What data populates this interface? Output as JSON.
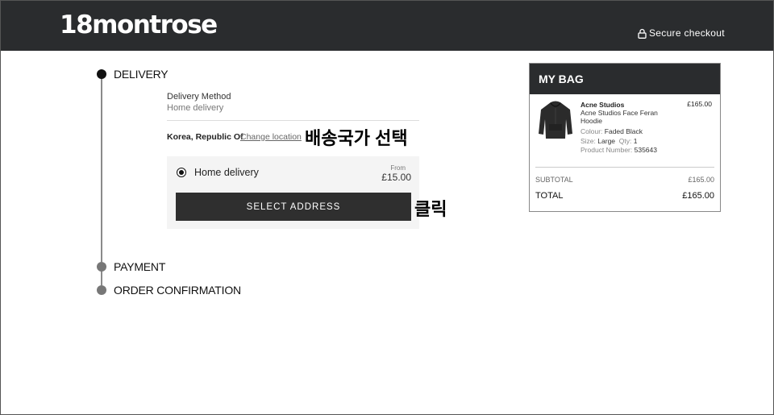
{
  "header": {
    "logo": "18montrose",
    "secure_checkout": "Secure checkout"
  },
  "steps": {
    "delivery": "DELIVERY",
    "payment": "PAYMENT",
    "order_confirmation": "ORDER CONFIRMATION"
  },
  "delivery": {
    "method_title": "Delivery Method",
    "method_value": "Home delivery",
    "country": "Korea, Republic Of",
    "change_location": "Change location",
    "option_label": "Home delivery",
    "option_from": "From",
    "option_price": "£15.00",
    "select_address_button": "SELECT ADDRESS"
  },
  "annotations": {
    "select_country": "배송국가 선택",
    "click": "클릭"
  },
  "bag": {
    "title": "MY BAG",
    "item": {
      "brand": "Acne Studios",
      "name": "Acne Studios Face Feran Hoodie",
      "price": "£165.00",
      "colour_label": "Colour:",
      "colour_value": "Faded Black",
      "size_label": "Size:",
      "size_value": "Large",
      "qty_label": "Qty:",
      "qty_value": "1",
      "product_number_label": "Product Number:",
      "product_number_value": "535643",
      "image_icon": "hoodie-image"
    },
    "subtotal_label": "SUBTOTAL",
    "subtotal_value": "£165.00",
    "total_label": "TOTAL",
    "total_value": "£165.00"
  },
  "colors": {
    "header_bg": "#2a2c2e",
    "button_bg": "#2f2f2f",
    "option_bg": "#f4f4f4"
  }
}
